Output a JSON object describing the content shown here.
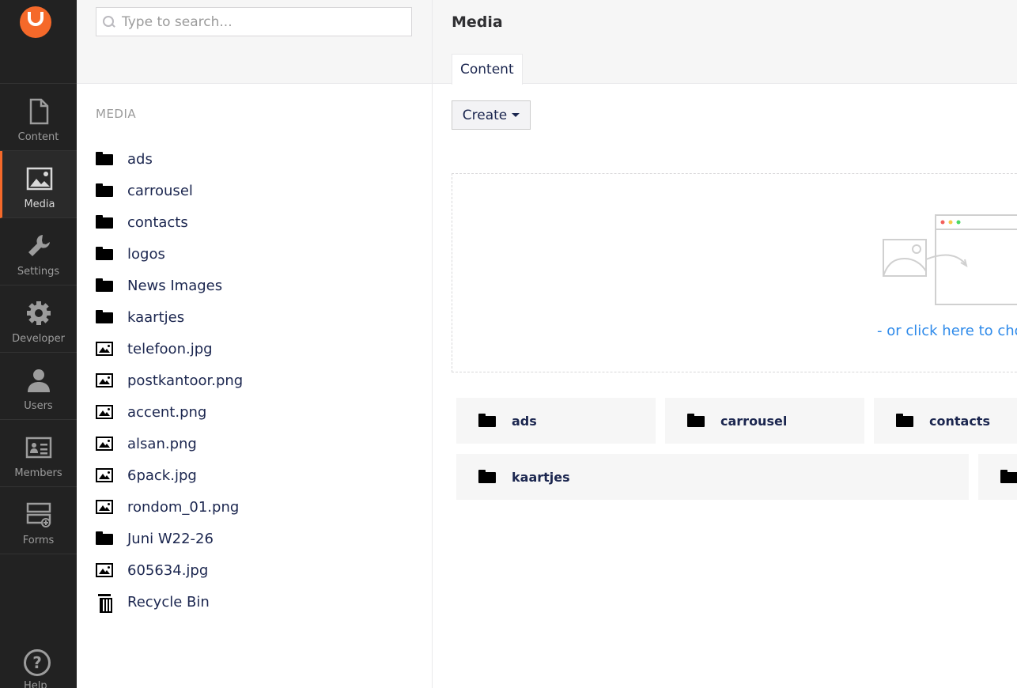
{
  "app": {
    "accent": "#f5692a",
    "rail_bg": "#222222"
  },
  "rail": {
    "items": [
      {
        "label": "Content",
        "icon": "document-icon"
      },
      {
        "label": "Media",
        "icon": "image-icon"
      },
      {
        "label": "Settings",
        "icon": "wrench-icon"
      },
      {
        "label": "Developer",
        "icon": "gear-icon"
      },
      {
        "label": "Users",
        "icon": "user-icon"
      },
      {
        "label": "Members",
        "icon": "id-card-icon"
      },
      {
        "label": "Forms",
        "icon": "forms-icon"
      }
    ],
    "help_label": "Help"
  },
  "search": {
    "placeholder": "Type to search..."
  },
  "tree": {
    "title": "MEDIA",
    "items": [
      {
        "label": "ads",
        "type": "folder"
      },
      {
        "label": "carrousel",
        "type": "folder"
      },
      {
        "label": "contacts",
        "type": "folder"
      },
      {
        "label": "logos",
        "type": "folder"
      },
      {
        "label": "News Images",
        "type": "folder"
      },
      {
        "label": "kaartjes",
        "type": "folder"
      },
      {
        "label": "telefoon.jpg",
        "type": "image"
      },
      {
        "label": "postkantoor.png",
        "type": "image"
      },
      {
        "label": "accent.png",
        "type": "image"
      },
      {
        "label": "alsan.png",
        "type": "image"
      },
      {
        "label": "6pack.jpg",
        "type": "image"
      },
      {
        "label": "rondom_01.png",
        "type": "image"
      },
      {
        "label": "Juni W22-26",
        "type": "folder"
      },
      {
        "label": "605634.jpg",
        "type": "image"
      },
      {
        "label": "Recycle Bin",
        "type": "trash"
      }
    ]
  },
  "main": {
    "title": "Media",
    "tab": "Content",
    "create_label": "Create",
    "dropzone_link": "- or click here to choo",
    "tiles": [
      {
        "label": "ads"
      },
      {
        "label": "carrousel"
      },
      {
        "label": "contacts"
      },
      {
        "label": "kaartjes"
      }
    ]
  }
}
